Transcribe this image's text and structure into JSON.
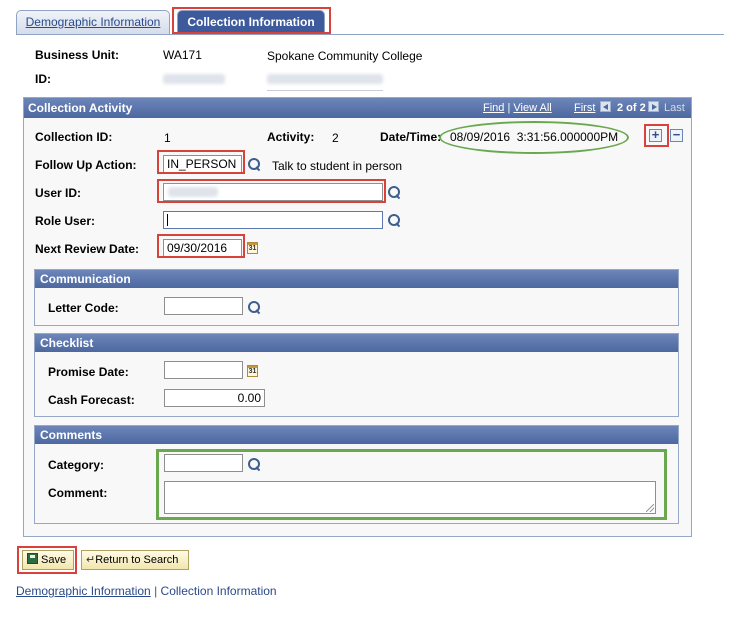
{
  "tabs": {
    "demographic": "Demographic Information",
    "collection": "Collection Information"
  },
  "header": {
    "business_unit_label": "Business Unit:",
    "business_unit_code": "WA171",
    "business_unit_name": "Spokane Community College",
    "id_label": "ID:"
  },
  "collection_activity": {
    "title": "Collection Activity",
    "nav": {
      "find": "Find",
      "separator": "|",
      "view_all": "View All",
      "first": "First",
      "position": "2 of 2",
      "last": "Last"
    },
    "collection_id_label": "Collection ID:",
    "collection_id": "1",
    "activity_label": "Activity:",
    "activity": "2",
    "datetime_label": "Date/Time:",
    "datetime": "08/09/2016  3:31:56.000000PM",
    "add_row": "+",
    "delete_row": "−",
    "follow_up_label": "Follow Up Action:",
    "follow_up_value": "IN_PERSON",
    "follow_up_desc": "Talk to student in person",
    "user_id_label": "User ID:",
    "user_id_value": "",
    "role_user_label": "Role User:",
    "role_user_value": "",
    "next_review_label": "Next Review Date:",
    "next_review_value": "09/30/2016",
    "calendar_glyph": "31"
  },
  "communication": {
    "title": "Communication",
    "letter_code_label": "Letter Code:",
    "letter_code_value": ""
  },
  "checklist": {
    "title": "Checklist",
    "promise_date_label": "Promise Date:",
    "promise_date_value": "",
    "cash_forecast_label": "Cash Forecast:",
    "cash_forecast_value": "0.00"
  },
  "comments": {
    "title": "Comments",
    "category_label": "Category:",
    "category_value": "",
    "comment_label": "Comment:",
    "comment_value": ""
  },
  "buttons": {
    "save": "Save",
    "return_to_search": "Return to Search"
  },
  "footer": {
    "demographic_link": "Demographic Information",
    "separator": "|",
    "collection_link": "Collection Information"
  },
  "colors": {
    "header_blue": "#4d68a0",
    "highlight_red": "#d9423b",
    "highlight_green": "#6aa84f"
  }
}
